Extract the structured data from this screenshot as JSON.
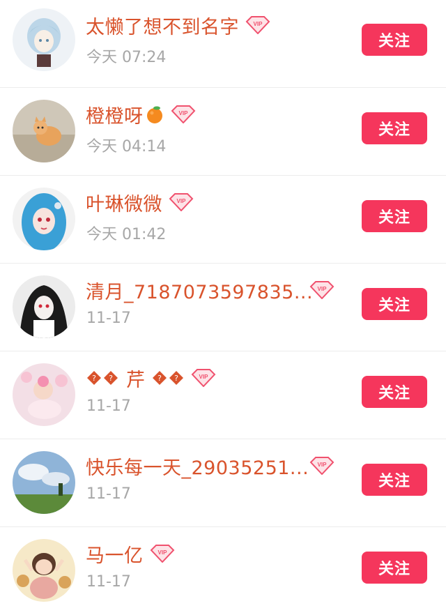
{
  "users": [
    {
      "name": "太懒了想不到名字",
      "time": "今天 07:24",
      "follow_label": "关注"
    },
    {
      "name": "橙橙呀",
      "time": "今天 04:14",
      "follow_label": "关注"
    },
    {
      "name": "叶琳微微",
      "time": "今天 01:42",
      "follow_label": "关注"
    },
    {
      "name": "清月_7187073597835...",
      "time": "11-17",
      "follow_label": "关注"
    },
    {
      "name": "芹",
      "time": "11-17",
      "follow_label": "关注"
    },
    {
      "name": "快乐每一天_29035251...",
      "time": "11-17",
      "follow_label": "关注"
    },
    {
      "name": "马一亿",
      "time": "11-17",
      "follow_label": "关注"
    }
  ],
  "badge": {
    "vip_text": "VIP"
  },
  "colors": {
    "name": "#d9532c",
    "time": "#a7a7a7",
    "follow_bg": "#f5365c",
    "vip": "#f0516e"
  }
}
